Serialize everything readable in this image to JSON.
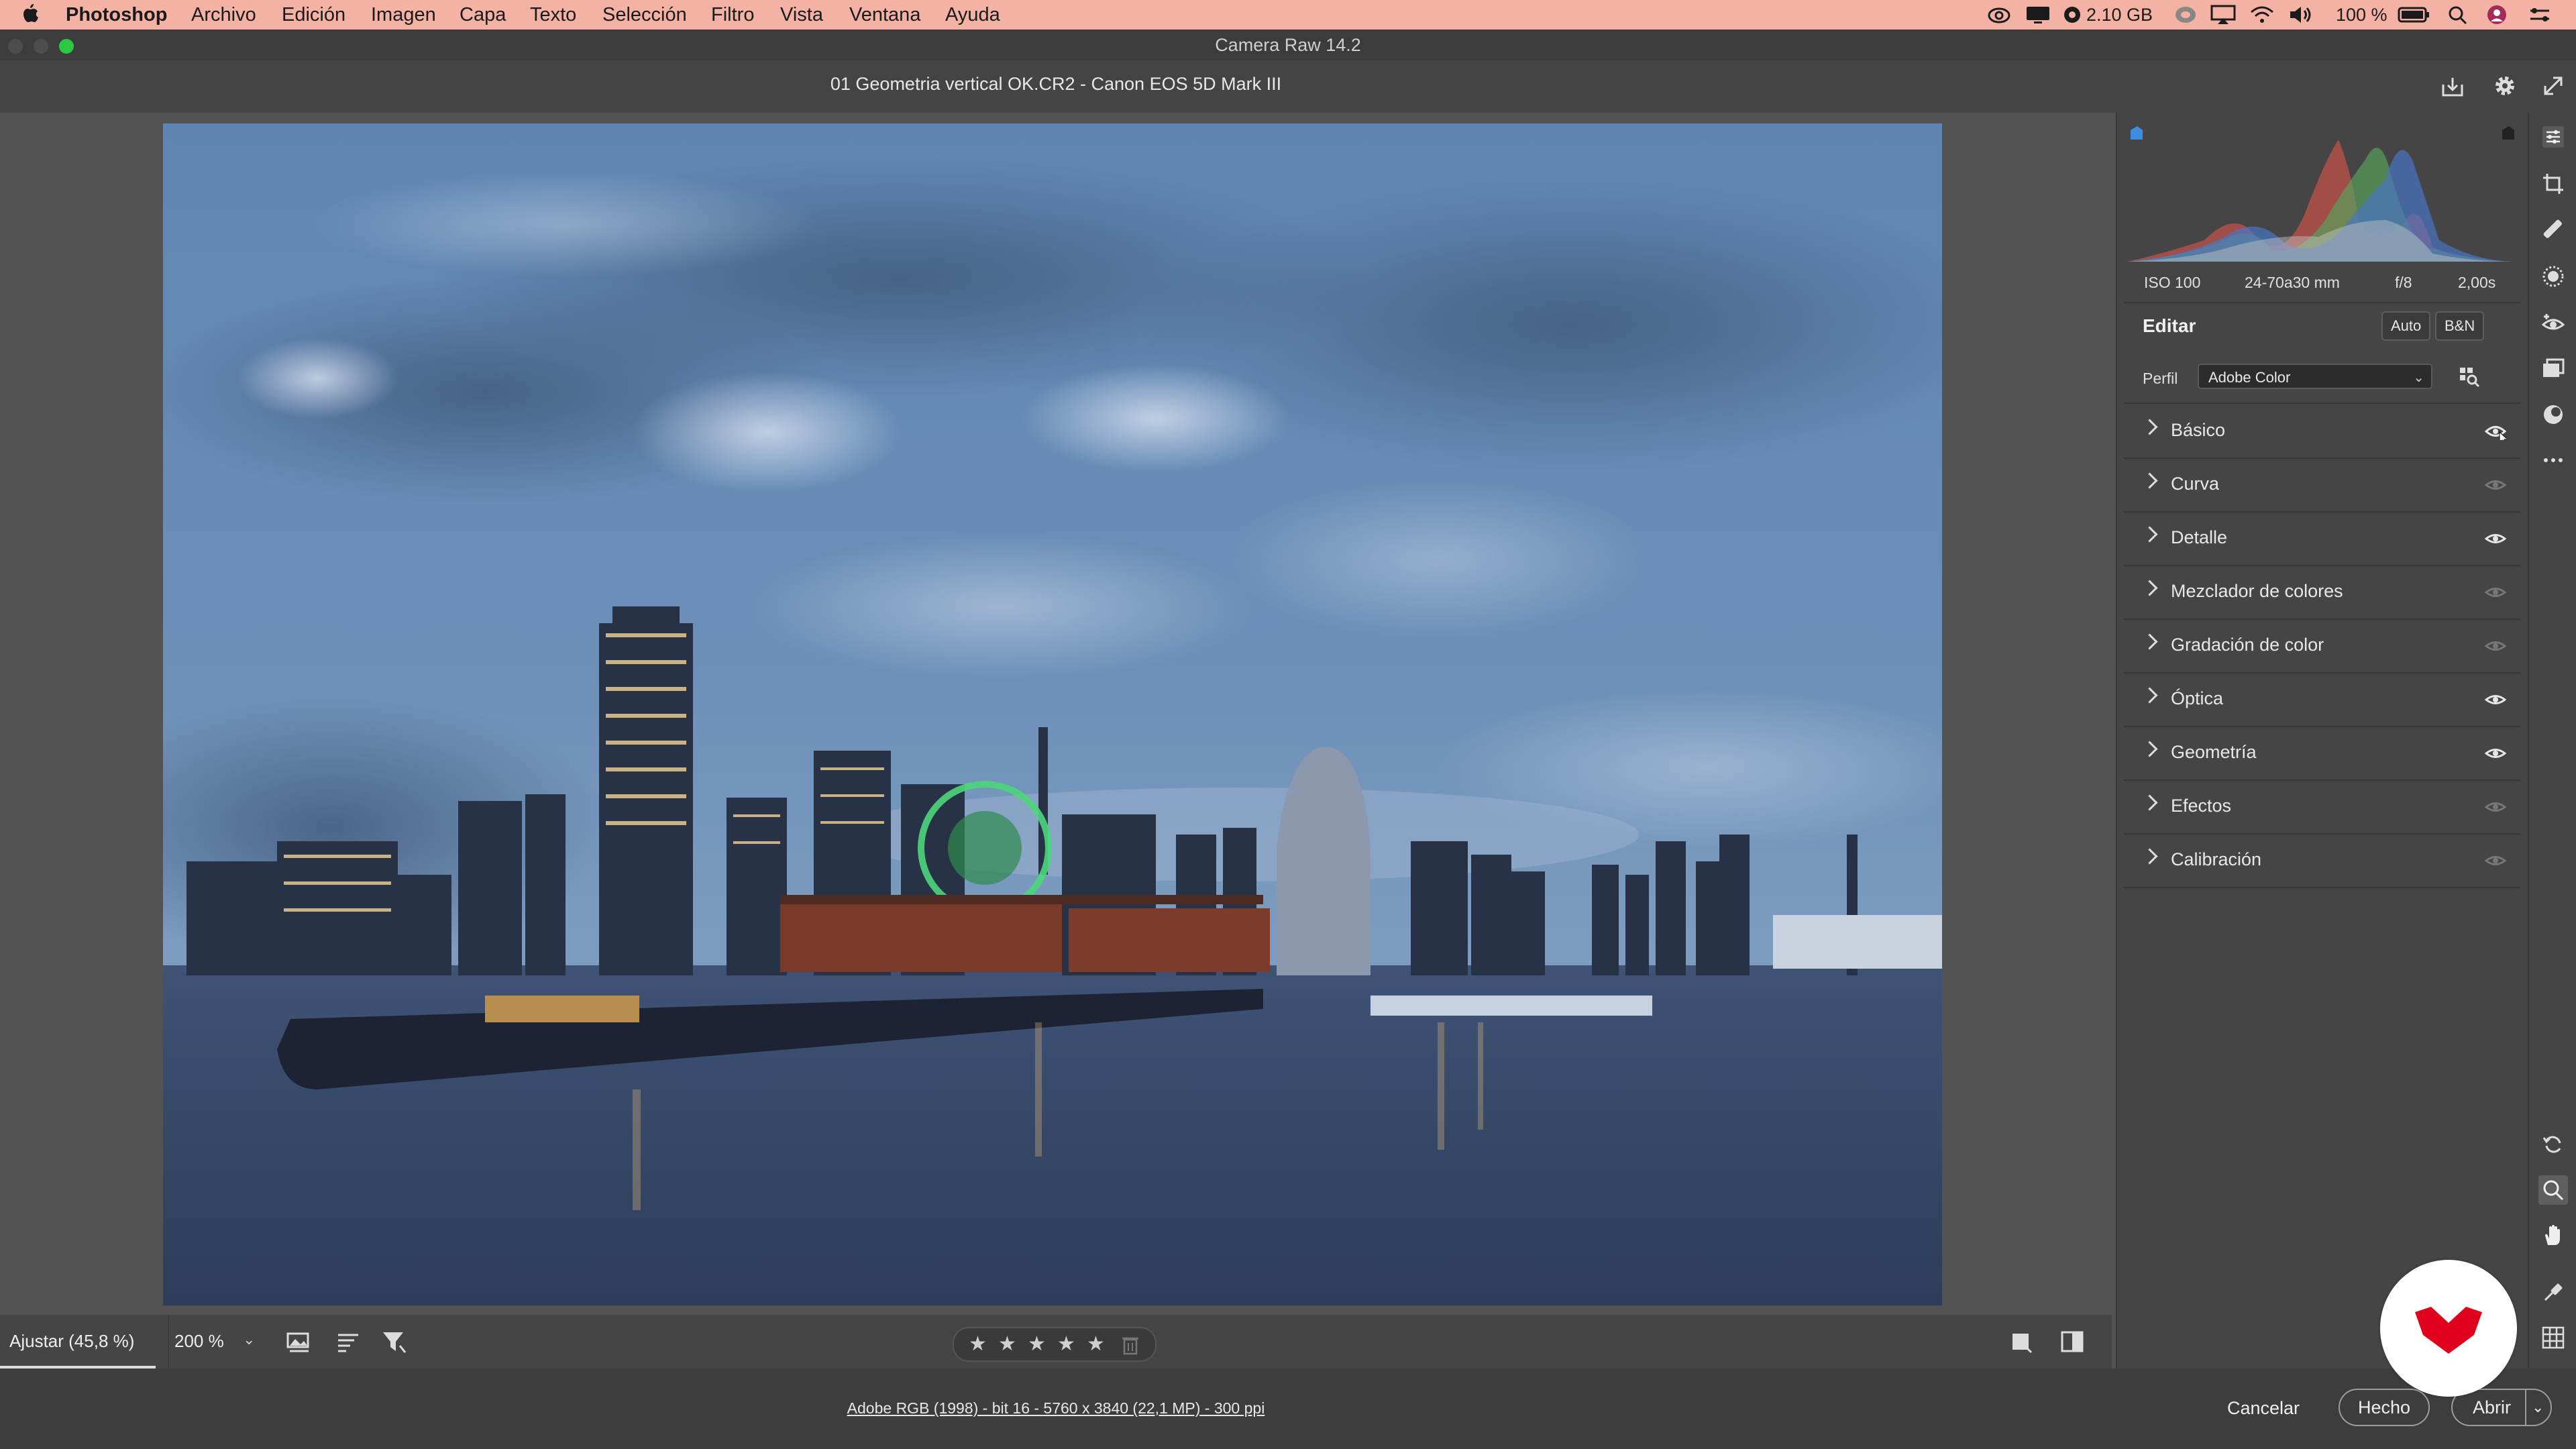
{
  "menubar": {
    "app": "Photoshop",
    "items": [
      "Archivo",
      "Edición",
      "Imagen",
      "Capa",
      "Texto",
      "Selección",
      "Filtro",
      "Vista",
      "Ventana",
      "Ayuda"
    ],
    "memory": "2.10 GB",
    "battery": "100 %"
  },
  "window": {
    "title": "Camera Raw 14.2"
  },
  "file": {
    "name": "01 Geometria vertical OK.CR2 -  Canon EOS 5D Mark III"
  },
  "exif": {
    "iso": "ISO 100",
    "lens": "24-70a30 mm",
    "aperture": "f/8",
    "shutter": "2,00s"
  },
  "edit": {
    "title": "Editar",
    "auto_label": "Auto",
    "bw_label": "B&N",
    "profile_label": "Perfil",
    "profile_value": "Adobe Color",
    "sections": [
      {
        "label": "Básico",
        "eye": "hover"
      },
      {
        "label": "Curva",
        "eye": "dim"
      },
      {
        "label": "Detalle",
        "eye": "on"
      },
      {
        "label": "Mezclador de colores",
        "eye": "dim"
      },
      {
        "label": "Gradación de color",
        "eye": "dim"
      },
      {
        "label": "Óptica",
        "eye": "on"
      },
      {
        "label": "Geometría",
        "eye": "on"
      },
      {
        "label": "Efectos",
        "eye": "dim"
      },
      {
        "label": "Calibración",
        "eye": "dim"
      }
    ]
  },
  "bottom": {
    "zoom_fit": "Ajustar (45,8 %)",
    "zoom_level": "200 %",
    "rating_stars": 5
  },
  "footer": {
    "info": "Adobe RGB (1998) - bit 16 - 5760 x 3840 (22,1 MP) - 300 ppi",
    "cancel": "Cancelar",
    "done": "Hecho",
    "open": "Abrir"
  },
  "colors": {
    "accent_menubar": "#f4b2a4",
    "panel": "#454545",
    "logo_red": "#e0001b"
  }
}
